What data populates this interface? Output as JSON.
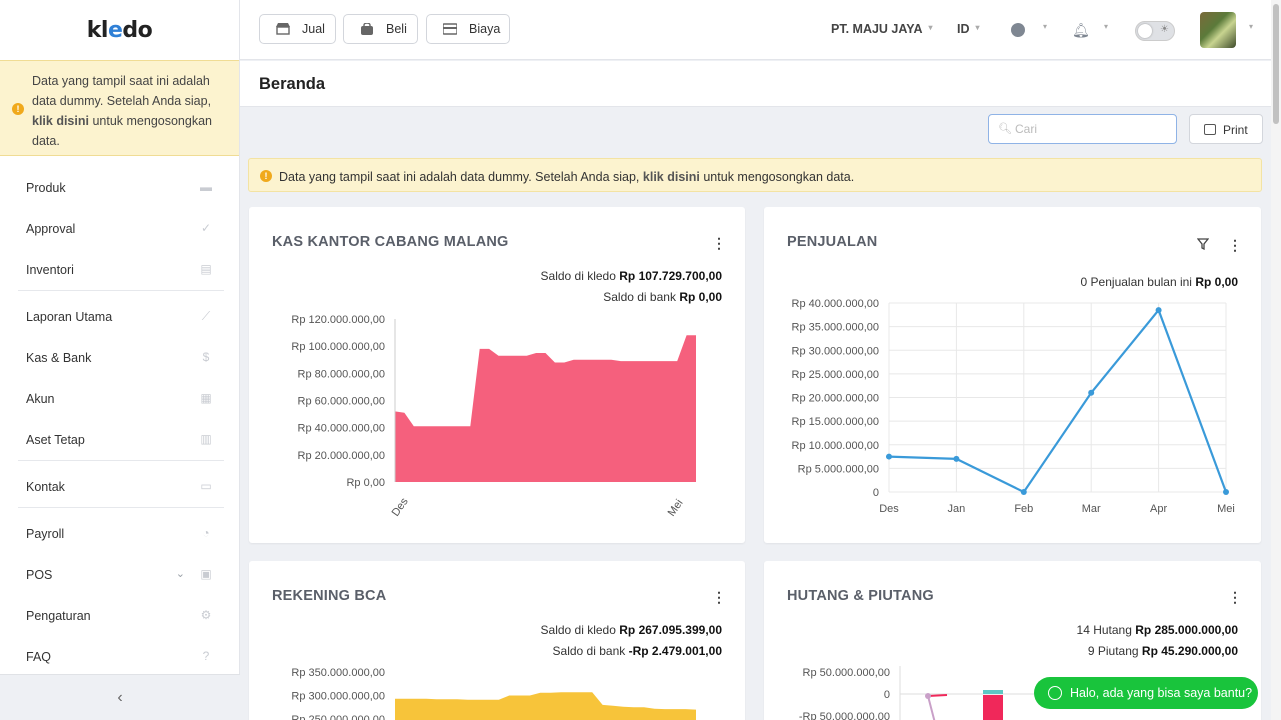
{
  "app": {
    "logo_text_a": "kl",
    "logo_text_e": "e",
    "logo_text_b": "do"
  },
  "sidebar": {
    "warning": {
      "text_before": "Data yang tampil saat ini adalah data dummy. Setelah Anda siap,",
      "link": "klik disini",
      "text_after": "untuk mengosongkan data."
    },
    "items": [
      {
        "label": "Produk",
        "icon": "box-icon"
      },
      {
        "label": "Approval",
        "icon": "check-icon"
      },
      {
        "label": "Inventori",
        "icon": "warehouse-icon"
      },
      {
        "label": "Laporan Utama",
        "icon": "chart-icon"
      },
      {
        "label": "Kas & Bank",
        "icon": "dollar-icon"
      },
      {
        "label": "Akun",
        "icon": "list-icon"
      },
      {
        "label": "Aset Tetap",
        "icon": "building-icon"
      },
      {
        "label": "Kontak",
        "icon": "contact-card-icon"
      },
      {
        "label": "Payroll",
        "icon": "payroll-icon"
      },
      {
        "label": "POS",
        "icon": "pos-icon"
      },
      {
        "label": "Pengaturan",
        "icon": "gear-icon"
      },
      {
        "label": "FAQ",
        "icon": "question-icon"
      }
    ],
    "collapse_glyph": "‹"
  },
  "topbar": {
    "buttons": [
      {
        "label": "Jual",
        "icon": "shop-icon"
      },
      {
        "label": "Beli",
        "icon": "bag-icon"
      },
      {
        "label": "Biaya",
        "icon": "card-icon"
      }
    ],
    "company": "PT. MAJU JAYA",
    "language": "ID"
  },
  "page": {
    "title": "Beranda",
    "search_placeholder": "Cari",
    "print_label": "Print",
    "warning": {
      "text_before": "Data yang tampil saat ini adalah data dummy. Setelah Anda siap,",
      "link": "klik disini",
      "text_after": "untuk mengosongkan data."
    }
  },
  "cards": {
    "kas": {
      "title": "KAS KANTOR CABANG MALANG",
      "saldo_kledo_label": "Saldo di kledo",
      "saldo_kledo_value": "Rp 107.729.700,00",
      "saldo_bank_label": "Saldo di bank",
      "saldo_bank_value": "Rp 0,00"
    },
    "penjualan": {
      "title": "PENJUALAN",
      "summary_label": "0 Penjualan bulan ini",
      "summary_value": "Rp 0,00"
    },
    "bca": {
      "title": "REKENING BCA",
      "saldo_kledo_label": "Saldo di kledo",
      "saldo_kledo_value": "Rp 267.095.399,00",
      "saldo_bank_label": "Saldo di bank",
      "saldo_bank_value": "-Rp 2.479.001,00"
    },
    "hutang": {
      "title": "HUTANG & PIUTANG",
      "hutang_label": "14 Hutang",
      "hutang_value": "Rp 285.000.000,00",
      "piutang_label": "9 Piutang",
      "piutang_value": "Rp 45.290.000,00"
    }
  },
  "chat": {
    "label": "Halo, ada yang bisa saya bantu?"
  },
  "colors": {
    "kas_area": "#f5607d",
    "penjualan_line": "#3a9ad9",
    "bca_area": "#f7c43a",
    "hutang_bar": "#f0285a",
    "piutang_bar": "#5cc8c4"
  },
  "chart_data": [
    {
      "type": "area",
      "title": "KAS KANTOR CABANG MALANG",
      "x_tick_labels": [
        "Des",
        "Mei"
      ],
      "y_tick_labels": [
        "Rp 0,00",
        "Rp 20.000.000,00",
        "Rp 40.000.000,00",
        "Rp 60.000.000,00",
        "Rp 80.000.000,00",
        "Rp 100.000.000,00",
        "Rp 120.000.000,00"
      ],
      "ylim": [
        0,
        120000000
      ],
      "values": [
        52000000,
        51000000,
        41000000,
        41000000,
        41000000,
        41000000,
        41000000,
        41000000,
        41000000,
        98000000,
        98000000,
        93000000,
        93000000,
        93000000,
        93000000,
        95000000,
        95000000,
        88000000,
        88000000,
        90000000,
        90000000,
        90000000,
        90000000,
        90000000,
        89000000,
        89000000,
        89000000,
        89000000,
        89000000,
        89000000,
        89000000,
        108000000,
        108000000
      ]
    },
    {
      "type": "line",
      "title": "PENJUALAN",
      "categories": [
        "Des",
        "Jan",
        "Feb",
        "Mar",
        "Apr",
        "Mei"
      ],
      "values": [
        7500000,
        7000000,
        0,
        21000000,
        38500000,
        0
      ],
      "y_tick_labels": [
        "0",
        "Rp 5.000.000,00",
        "Rp 10.000.000,00",
        "Rp 15.000.000,00",
        "Rp 20.000.000,00",
        "Rp 25.000.000,00",
        "Rp 30.000.000,00",
        "Rp 35.000.000,00",
        "Rp 40.000.000,00"
      ],
      "ylim": [
        0,
        40000000
      ],
      "grid": true
    },
    {
      "type": "area",
      "title": "REKENING BCA",
      "y_tick_labels": [
        "Rp 250.000.000,00",
        "Rp 300.000.000,00",
        "Rp 350.000.000,00"
      ],
      "ylim": [
        250000000,
        350000000
      ],
      "values": [
        293000000,
        293000000,
        293000000,
        293000000,
        292000000,
        292000000,
        292000000,
        291000000,
        291000000,
        291000000,
        291000000,
        300000000,
        300000000,
        300000000,
        306000000,
        306000000,
        307000000,
        307000000,
        307000000,
        307000000,
        280000000,
        278000000,
        276000000,
        275000000,
        275000000,
        272000000,
        271000000,
        271000000,
        271000000,
        270000000
      ]
    },
    {
      "type": "bar",
      "title": "HUTANG & PIUTANG",
      "y_tick_labels": [
        "-Rp 50.000.000,00",
        "0",
        "Rp 50.000.000,00"
      ],
      "ylim": [
        -50000000,
        50000000
      ]
    }
  ]
}
